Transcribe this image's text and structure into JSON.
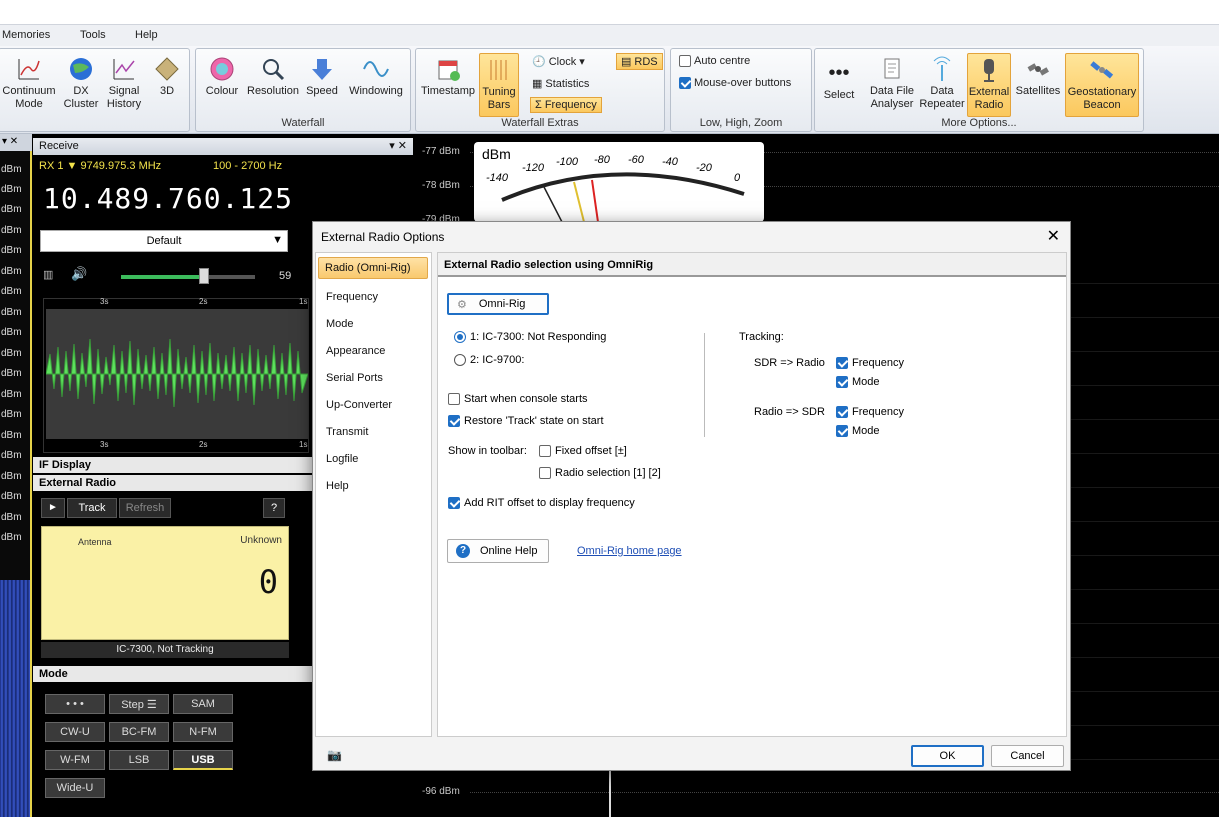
{
  "menu": [
    "Memories",
    "Tools",
    "Help"
  ],
  "ribbon": {
    "main": {
      "buttons": [
        {
          "label": "Continuum\nMode",
          "icon": "chart-icon"
        },
        {
          "label": "DX\nCluster",
          "icon": "globe-icon"
        },
        {
          "label": "Signal\nHistory",
          "icon": "history-chart-icon"
        },
        {
          "label": "3D",
          "icon": "3d-icon"
        }
      ]
    },
    "waterfall": {
      "label": "Waterfall",
      "buttons": [
        "Colour",
        "Resolution",
        "Speed",
        "Windowing"
      ]
    },
    "extras": {
      "label": "Waterfall Extras",
      "timestamp": "Timestamp",
      "tuning_bars": "Tuning\nBars",
      "clock": "Clock",
      "statistics": "Statistics",
      "frequency": "Frequency",
      "rds": "RDS"
    },
    "zoom": {
      "label": "Low, High, Zoom",
      "auto_centre": "Auto centre",
      "mouse_over": "Mouse-over buttons"
    },
    "more": {
      "label": "More Options...",
      "buttons": [
        "Select",
        "Data File\nAnalyser",
        "Data\nRepeater",
        "External\nRadio",
        "Satellites",
        "Geostationary\nBeacon"
      ]
    }
  },
  "receive": {
    "title": "Receive",
    "rx": "RX 1 ▼ 9749.975.3 MHz",
    "range": "100 - 2700 Hz",
    "frequency": "10.489.760.125",
    "preset": "Default",
    "volume": "59",
    "volume_level": 0.62,
    "scale_top": [
      "3s",
      "2s",
      "1s"
    ],
    "scale_bottom": [
      "3s",
      "2s",
      "1s"
    ],
    "if_display": "IF Display",
    "external_radio": "External Radio",
    "track": "Track",
    "refresh": "Refresh",
    "help": "?",
    "antenna": "Antenna",
    "unknown": "Unknown",
    "value": "0",
    "status": "IC-7300, Not Tracking",
    "mode_label": "Mode",
    "modes": [
      "• • •",
      "Step ☰",
      "SAM",
      "CW-U",
      "BC-FM",
      "N-FM",
      "W-FM",
      "LSB",
      "USB",
      "Wide-U"
    ]
  },
  "left_dbm": [
    "dBm",
    "dBm",
    "dBm",
    "dBm",
    "dBm",
    "dBm",
    "dBm",
    "dBm",
    "dBm",
    "dBm",
    "dBm",
    "dBm",
    "dBm",
    "dBm",
    "dBm",
    "dBm",
    "dBm",
    "dBm",
    "dBm"
  ],
  "spectrum": {
    "dbm_labels": [
      "-77 dBm",
      "-78 dBm",
      "-79 dBm",
      "-96 dBm"
    ],
    "meter_title": "dBm",
    "meter_ticks": [
      "-140",
      "-120",
      "-100",
      "-80",
      "-60",
      "-40",
      "-20",
      "0"
    ]
  },
  "dialog": {
    "title": "External Radio Options",
    "nav": [
      "Radio (Omni-Rig)",
      "Frequency",
      "Mode",
      "Appearance",
      "Serial Ports",
      "Up-Converter",
      "Transmit",
      "Logfile",
      "Help"
    ],
    "header": "External Radio selection using OmniRig",
    "omnirig_button": "Omni-Rig",
    "radio1": "1:   IC-7300: Not Responding",
    "radio2": "2:   IC-9700:",
    "start_console": "Start when console starts",
    "restore_track": "Restore 'Track' state on start",
    "show_toolbar": "Show in toolbar:",
    "fixed_offset": "Fixed offset [±]",
    "radio_selection": "Radio selection [1] [2]",
    "add_rit": "Add RIT offset to display frequency",
    "tracking": "Tracking:",
    "sdr_radio": "SDR => Radio",
    "radio_sdr": "Radio => SDR",
    "frequency": "Frequency",
    "mode": "Mode",
    "online_help": "Online Help",
    "home_page": "Omni-Rig home page",
    "ok": "OK",
    "cancel": "Cancel"
  }
}
